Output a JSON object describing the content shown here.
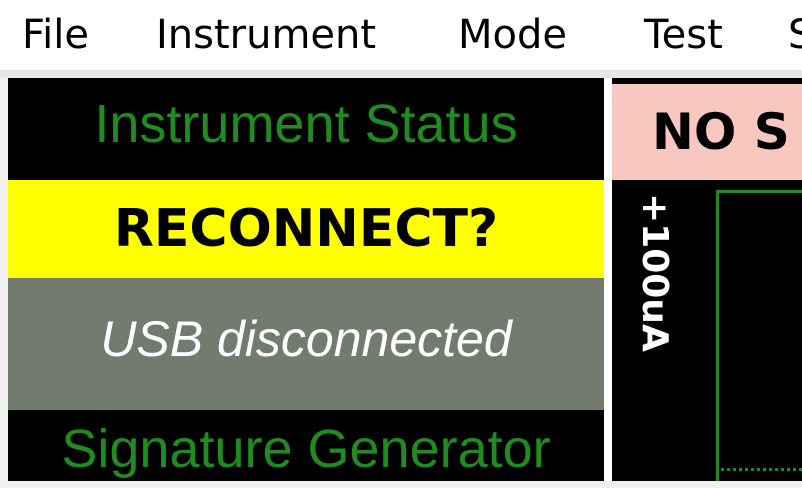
{
  "menu": {
    "items": [
      "File",
      "Instrument",
      "Mode",
      "Test",
      "S"
    ]
  },
  "left_panel": {
    "instrument_status_title": "Instrument Status",
    "reconnect_button_label": "RECONNECT?",
    "usb_status_text": "USB disconnected",
    "signature_generator_title": "Signature Generator"
  },
  "right_panel": {
    "no_signal_text": "NO S",
    "y_range_label": "+100uA"
  },
  "colors": {
    "status_green": "#1e8c1e",
    "reconnect_yellow": "#ffff00",
    "usb_status_gray": "#737b6e",
    "no_signal_pink": "#f8c8c0"
  }
}
